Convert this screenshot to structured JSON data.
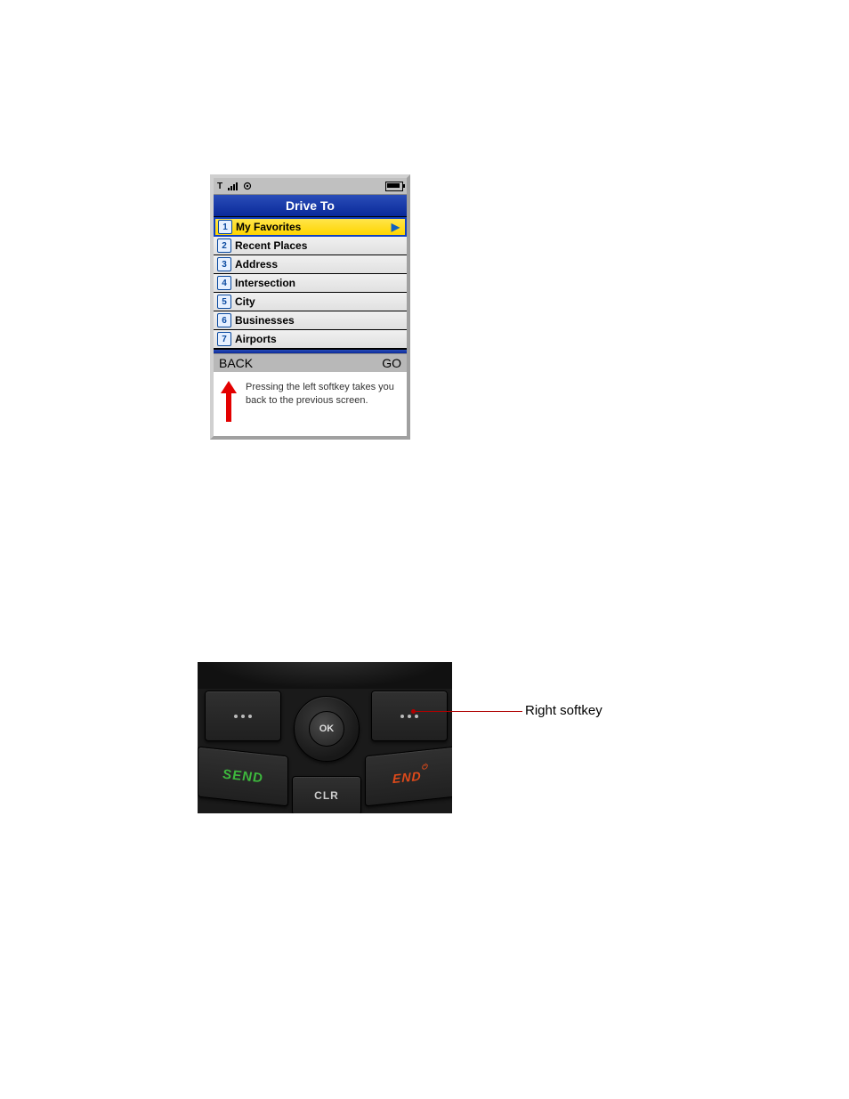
{
  "phone": {
    "title": "Drive To",
    "menu": [
      {
        "num": "1",
        "label": "My Favorites",
        "selected": true,
        "hasArrow": true
      },
      {
        "num": "2",
        "label": "Recent Places"
      },
      {
        "num": "3",
        "label": "Address"
      },
      {
        "num": "4",
        "label": "Intersection"
      },
      {
        "num": "5",
        "label": "City"
      },
      {
        "num": "6",
        "label": "Businesses"
      },
      {
        "num": "7",
        "label": "Airports"
      }
    ],
    "softkeys": {
      "left": "BACK",
      "right": "GO"
    },
    "caption": "Pressing the left softkey takes you back to the previous screen."
  },
  "keypad": {
    "ok": "OK",
    "send": "SEND",
    "end": "END",
    "clr": "CLR",
    "callout": "Right softkey"
  }
}
